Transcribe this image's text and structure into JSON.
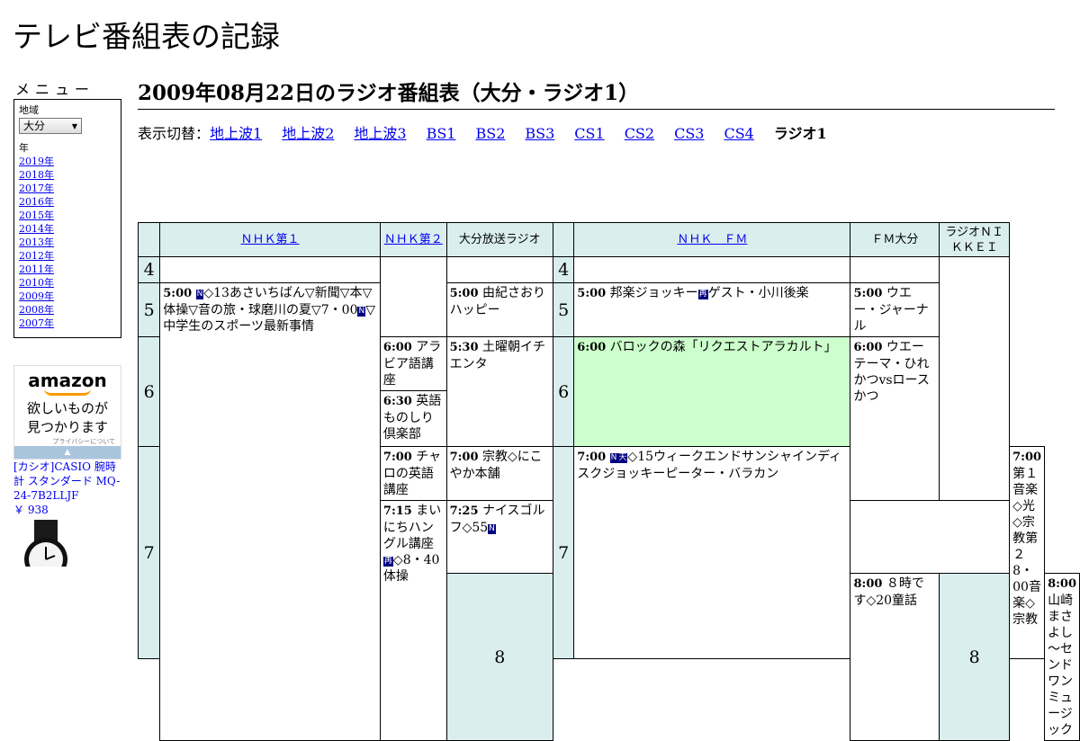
{
  "site": {
    "title": "テレビ番組表の記録"
  },
  "menu": {
    "title": "メニュー",
    "region_label": "地域",
    "region_selected": "大分",
    "year_label": "年",
    "years": [
      "2019年",
      "2018年",
      "2017年",
      "2016年",
      "2015年",
      "2014年",
      "2013年",
      "2012年",
      "2011年",
      "2010年",
      "2009年",
      "2008年",
      "2007年"
    ]
  },
  "ad": {
    "logo": "amazon",
    "message_1": "欲しいものが",
    "message_2": "見つかります",
    "privacy": "プライバシーについて",
    "product_name": "[カシオ]CASIO 腕時計 スタンダード MQ-24-7B2LLJF",
    "product_price": "￥ 938"
  },
  "page": {
    "heading": "2009年08月22日のラジオ番組表（大分・ラジオ1）"
  },
  "switcher": {
    "label": "表示切替：",
    "links": [
      "地上波1",
      "地上波2",
      "地上波3",
      "BS1",
      "BS2",
      "BS3",
      "CS1",
      "CS2",
      "CS3",
      "CS4"
    ],
    "current": "ラジオ1"
  },
  "schedule": {
    "channels": [
      "ＮＨＫ第１",
      "ＮＨＫ第２",
      "大分放送ラジオ",
      "ＮＨＫ　ＦＭ",
      "ＦＭ大分",
      "ラジオＮＩＫＫＥＩ"
    ],
    "hours": [
      "4",
      "5",
      "6",
      "7",
      "8"
    ],
    "nhk1": {
      "p1_time": "5:00",
      "p1_badge1": "N",
      "p1_a": "◇13あさいちばん▽新聞▽本▽体操▽音の旅・球磨川の夏▽7・00",
      "p1_badge2": "N",
      "p1_b": "▽中学生のスポーツ最新事情"
    },
    "nhk2": {
      "p1_time": "6:00",
      "p1_title": "アラビア語講座",
      "p2_time": "6:30",
      "p2_title": "英語ものしり倶楽部",
      "p3_time": "7:00",
      "p3_title": "チャロの英語講座",
      "p4_time": "7:15",
      "p4_title": "まいにちハングル講座",
      "p4_badge": "再",
      "p4_rest": "◇8・40体操"
    },
    "obs": {
      "p1_time": "5:00",
      "p1_title": "由紀さおりハッピー",
      "p2_time": "5:30",
      "p2_title": "土曜朝イチエンタ",
      "p3_time": "7:00",
      "p3_title": "宗教◇にこやか本舗",
      "p4_time": "7:25",
      "p4_title": "ナイスゴルフ◇55",
      "p4_badge": "N",
      "p5_time": "8:00",
      "p5_title": "８時です◇20童話"
    },
    "nhkfm": {
      "p1_time": "5:00",
      "p1_title": "邦楽ジョッキー",
      "p1_badge": "再",
      "p1_rest": "ゲスト・小川後楽",
      "p2_time": "6:00",
      "p2_title": "バロックの森「リクエストアラカルト」",
      "p3_time": "7:00",
      "p3_badge1": "N",
      "p3_badge2": "天",
      "p3_title": "◇15ウィークエンドサンシャインディスクジョッキーピーター・バラカン"
    },
    "fmoita": {
      "p1_time": "5:00",
      "p1_title": "ウエー・ジャーナル",
      "p2_time": "6:00",
      "p2_title": "ウエーテーマ・ひれかつvsロースかつ",
      "p3_time": "8:00",
      "p3_title": "山崎まさよし～センドワンミュージック"
    },
    "nikkei": {
      "p1_time": "7:00",
      "p1_title": "第１音楽◇光◇宗教第２8・00音楽◇宗教"
    }
  }
}
